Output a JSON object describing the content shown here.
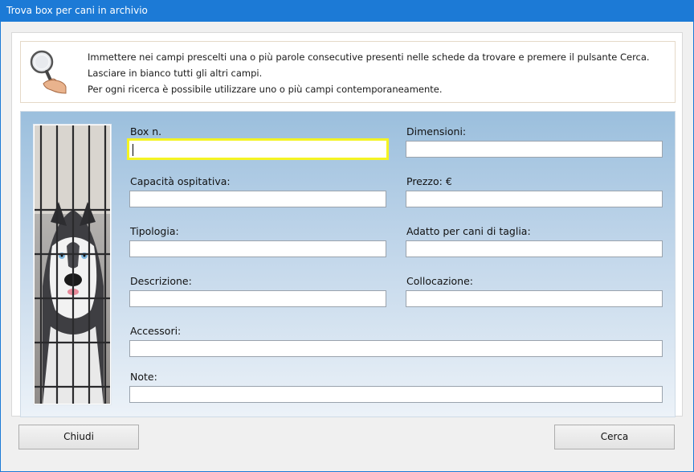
{
  "window": {
    "title": "Trova box per cani in archivio"
  },
  "info": {
    "line1": "Immettere nei campi prescelti una o più parole consecutive presenti nelle schede da trovare e premere il pulsante Cerca.",
    "line2": "Lasciare in bianco tutti gli altri campi.",
    "line3": "Per ogni ricerca è possibile utilizzare uno o più campi contemporaneamente."
  },
  "fields": {
    "box_n": {
      "label": "Box n.",
      "value": ""
    },
    "dimensioni": {
      "label": "Dimensioni:",
      "value": ""
    },
    "capacita": {
      "label": "Capacità ospitativa:",
      "value": ""
    },
    "prezzo": {
      "label": "Prezzo: €",
      "value": ""
    },
    "tipologia": {
      "label": "Tipologia:",
      "value": ""
    },
    "adatto": {
      "label": "Adatto per cani di taglia:",
      "value": ""
    },
    "descrizione": {
      "label": "Descrizione:",
      "value": ""
    },
    "collocazione": {
      "label": "Collocazione:",
      "value": ""
    },
    "accessori": {
      "label": "Accessori:",
      "value": ""
    },
    "note": {
      "label": "Note:",
      "value": ""
    }
  },
  "buttons": {
    "close": "Chiudi",
    "search": "Cerca"
  },
  "colors": {
    "titlebar": "#1c7ad6",
    "focus_border": "#f4f424",
    "form_top": "#9bbfdd",
    "form_bottom": "#ecf2f8"
  },
  "icons": {
    "info": "magnifier-hand-icon",
    "photo": "dog-in-kennel-photo"
  }
}
